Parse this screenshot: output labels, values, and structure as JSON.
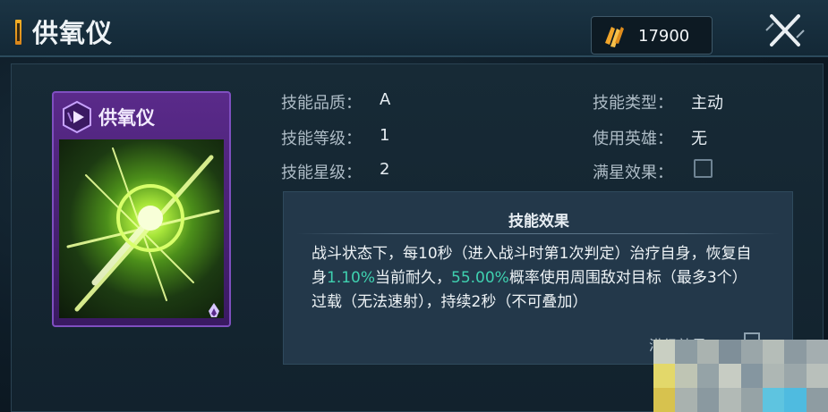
{
  "header": {
    "title": "供氧仪",
    "currency_icon": "crystal-shard-icon",
    "currency_value": "17900",
    "close_icon": "close-cross-icon"
  },
  "card": {
    "name": "供氧仪",
    "badge_icon": "hexagon-play-badge-icon",
    "corner_icon": "flame-rank-icon",
    "art": "green-energy-burst"
  },
  "info": {
    "quality_label": "技能品质：",
    "quality_value": "A",
    "level_label": "技能等级：",
    "level_value": "1",
    "star_label": "技能星级：",
    "star_value": "2",
    "type_label": "技能类型：",
    "type_value": "主动",
    "hero_label": "使用英雄：",
    "hero_value": "无",
    "maxstar_label": "满星效果："
  },
  "effect": {
    "title": "技能效果",
    "text_1": "战斗状态下，每10秒（进入战斗时第1次判定）治疗自身，恢复自身",
    "highlight_1": "1.10%",
    "text_2": "当前耐久，",
    "highlight_2": "55.00%",
    "text_3": "概率使用周围敌对目标（最多3个）过载（无法速射），持续2秒（不可叠加）",
    "faded_label": "满级效果"
  },
  "colors": {
    "accent": "#f5b026",
    "highlight": "#3fd1b0",
    "card_purple": "#7f4fc0"
  }
}
